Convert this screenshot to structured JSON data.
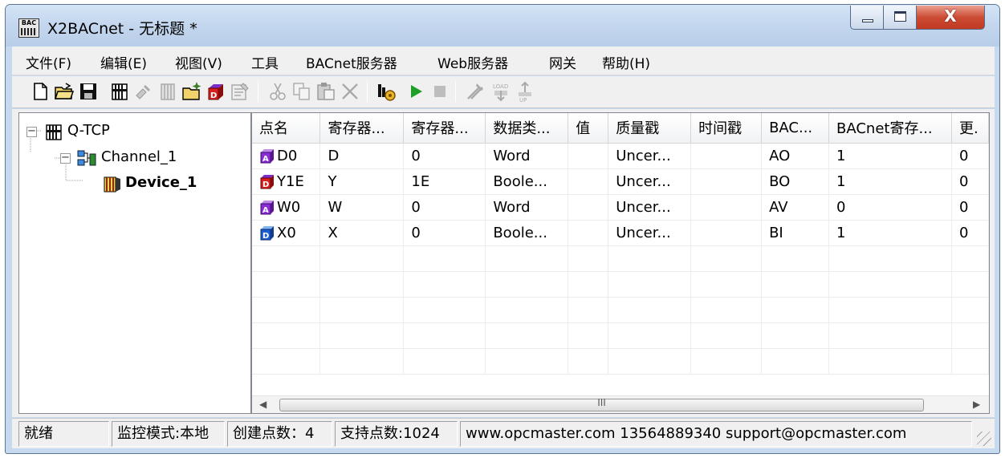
{
  "window": {
    "title": "X2BACnet - 无标题 *",
    "app_icon_label": "BAC",
    "close_glyph": "X"
  },
  "menu": [
    "文件(F)",
    "编辑(E)",
    "视图(V)",
    "工具",
    "BACnet服务器",
    "Web服务器",
    "网关",
    "帮助(H)"
  ],
  "toolbar_icons": [
    "new-file-icon",
    "open-folder-icon",
    "save-icon",
    "add-channel-icon",
    "add-device-icon",
    "add-device-alt-icon",
    "new-point-icon",
    "new-tag-icon",
    "properties-icon",
    "cut-icon",
    "copy-icon",
    "paste-icon",
    "delete-icon",
    "monitor-icon",
    "run-icon",
    "stop-icon",
    "tools-icon",
    "load-icon",
    "upload-icon"
  ],
  "tree": {
    "root": "Q-TCP",
    "channel": "Channel_1",
    "device": "Device_1",
    "expand_glyph": "−"
  },
  "table": {
    "columns": [
      "点名",
      "寄存器...",
      "寄存器...",
      "数据类...",
      "值",
      "质量戳",
      "时间戳",
      "BAC...",
      "BACnet寄存...",
      "更."
    ],
    "rows": [
      {
        "icon": "ao",
        "icon_letter": "A",
        "cells": [
          "D0",
          "D",
          "0",
          "Word",
          "",
          "Uncer...",
          "",
          "AO",
          "1",
          "0"
        ]
      },
      {
        "icon": "bo",
        "icon_letter": "D",
        "cells": [
          "Y1E",
          "Y",
          "1E",
          "Boole...",
          "",
          "Uncer...",
          "",
          "BO",
          "1",
          "0"
        ]
      },
      {
        "icon": "av",
        "icon_letter": "A",
        "cells": [
          "W0",
          "W",
          "0",
          "Word",
          "",
          "Uncer...",
          "",
          "AV",
          "0",
          "0"
        ]
      },
      {
        "icon": "bi",
        "icon_letter": "D",
        "cells": [
          "X0",
          "X",
          "0",
          "Boole...",
          "",
          "Uncer...",
          "",
          "BI",
          "1",
          "0"
        ]
      }
    ]
  },
  "scrollbar": {
    "left_arrow": "◀",
    "right_arrow": "▶",
    "grip": "III"
  },
  "status": [
    "就绪",
    "监控模式:本地",
    "创建点数：4",
    "支持点数:1024",
    "www.opcmaster.com 13564889340 support@opcmaster.com"
  ]
}
